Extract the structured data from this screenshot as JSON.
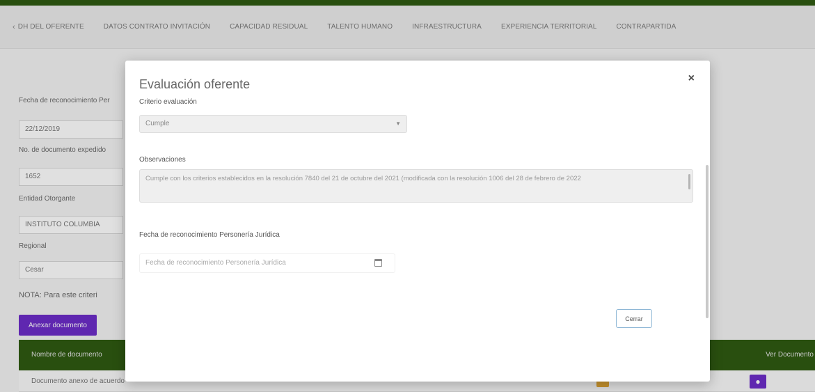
{
  "tabs": [
    {
      "label": "DH DEL OFERENTE"
    },
    {
      "label": "DATOS CONTRATO INVITACIÓN"
    },
    {
      "label": "CAPACIDAD RESIDUAL"
    },
    {
      "label": "TALENTO HUMANO"
    },
    {
      "label": "INFRAESTRUCTURA"
    },
    {
      "label": "EXPERIENCIA TERRITORIAL"
    },
    {
      "label": "CONTRAPARTIDA"
    }
  ],
  "background": {
    "fields": [
      {
        "label": "Fecha de reconocimiento Per",
        "value": "22/12/2019"
      },
      {
        "label": "No. de documento expedido",
        "value": "1652"
      },
      {
        "label": "Entidad Otorgante",
        "value": "INSTITUTO COLUMBIA"
      },
      {
        "label": "Regional",
        "value": "Cesar"
      }
    ],
    "note": "NOTA: Para este criteri",
    "attach_button": "Anexar documento",
    "table": {
      "col_left": "Nombre de documento",
      "col_right": "Ver Documento",
      "row_text": "Documento anexo de acuerdo",
      "row_mid": "(ilegible)"
    }
  },
  "modal": {
    "title": "Evaluación oferente",
    "close_symbol": "×",
    "criterion_label": "Criterio evaluación",
    "criterion_value": "Cumple",
    "observations_label": "Observaciones",
    "observations_text": "Cumple con los criterios establecidos en la resolución 7840 del 21 de octubre del 2021 (modificada con la resolución 1006 del 28 de febrero de 2022",
    "date_label": "Fecha de reconocimiento Personería Jurídica",
    "date_placeholder": "Fecha de reconocimiento Personería Jurídica",
    "close_button": "Cerrar"
  },
  "colors": {
    "brand_green": "#2f5a12",
    "accent_purple": "#6d2dc9",
    "badge_orange": "#e1a534"
  }
}
